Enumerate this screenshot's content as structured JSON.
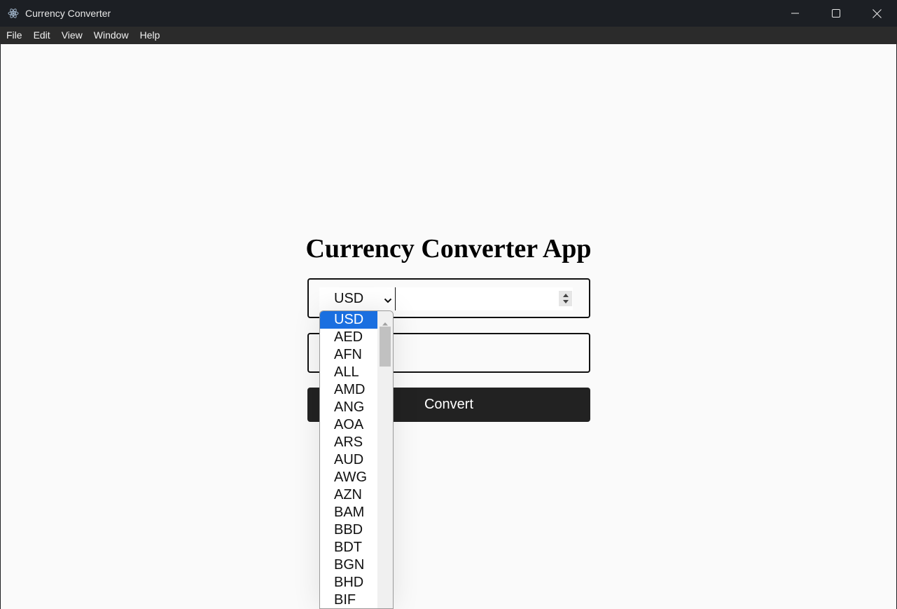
{
  "window": {
    "title": "Currency Converter"
  },
  "menu": {
    "items": [
      "File",
      "Edit",
      "View",
      "Window",
      "Help"
    ]
  },
  "app": {
    "heading": "Currency Converter App",
    "from_currency": "USD",
    "amount_value": "",
    "to_value": "",
    "convert_label": "Convert"
  },
  "dropdown": {
    "selected": "USD",
    "options": [
      "USD",
      "AED",
      "AFN",
      "ALL",
      "AMD",
      "ANG",
      "AOA",
      "ARS",
      "AUD",
      "AWG",
      "AZN",
      "BAM",
      "BBD",
      "BDT",
      "BGN",
      "BHD",
      "BIF"
    ]
  },
  "icons": {
    "app": "electron-icon",
    "minimize": "minimize-icon",
    "maximize": "maximize-icon",
    "close": "close-icon",
    "select_chevron": "chevron-down-icon",
    "spinner": "spin-buttons-icon"
  },
  "colors": {
    "accent": "#1a6fe0",
    "button": "#222222",
    "titlebar": "#1c1f24",
    "menubar": "#2b2b2b"
  }
}
